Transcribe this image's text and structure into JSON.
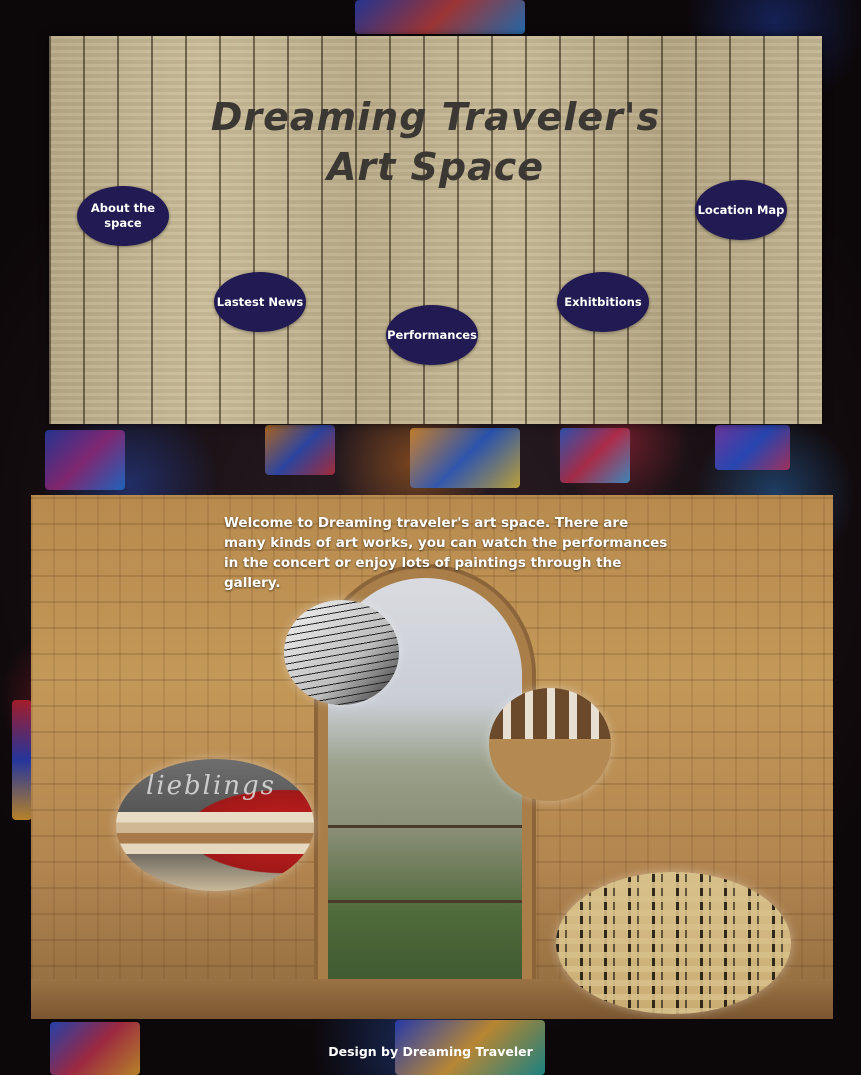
{
  "header": {
    "title_line1": "Dreaming Traveler's",
    "title_line2": "Art Space"
  },
  "nav": {
    "about": "About the space",
    "news": "Lastest News",
    "performances": "Performances",
    "exhibitions": "Exhitbitions",
    "location": "Location Map"
  },
  "main": {
    "welcome_text": "Welcome to Dreaming traveler's art space. There are many kinds of art works, you can watch the performances in the concert or enjoy lots of paintings through the gallery.",
    "books_pillow_text": "lieblings"
  },
  "footer": {
    "credit": "Design by Dreaming Traveler"
  },
  "colors": {
    "nav_button": "#221a52",
    "title_text": "#3b3732",
    "welcome_text": "#ffffff"
  }
}
